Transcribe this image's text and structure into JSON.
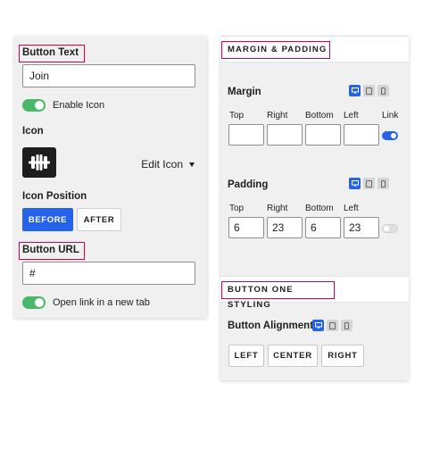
{
  "left": {
    "button_text": {
      "label": "Button Text",
      "value": "Join"
    },
    "enable_icon": {
      "label": "Enable Icon",
      "on": true
    },
    "icon": {
      "label": "Icon",
      "selected": "Edit Icon"
    },
    "icon_position": {
      "label": "Icon Position",
      "options": [
        "BEFORE",
        "AFTER"
      ],
      "selected": "BEFORE"
    },
    "button_url": {
      "label": "Button URL",
      "value": "#"
    },
    "new_tab": {
      "label": "Open link in a new tab",
      "on": true
    }
  },
  "right": {
    "margin_padding": {
      "title": "MARGIN & PADDING"
    },
    "margin": {
      "label": "Margin",
      "sides": [
        "Top",
        "Right",
        "Bottom",
        "Left"
      ],
      "link_label": "Link",
      "values": [
        "",
        "",
        "",
        ""
      ],
      "linked": true
    },
    "padding": {
      "label": "Padding",
      "sides": [
        "Top",
        "Right",
        "Bottom",
        "Left"
      ],
      "values": [
        "6",
        "23",
        "6",
        "23"
      ],
      "linked": false
    },
    "button_styling": {
      "title": "BUTTON ONE STYLING"
    },
    "alignment": {
      "label": "Button Alignment",
      "options": [
        "LEFT",
        "CENTER",
        "RIGHT"
      ]
    }
  },
  "colors": {
    "accent": "#2563eb",
    "toggle_on": "#4ab866",
    "highlight": "#d4004e"
  },
  "icons": {
    "device_icons": [
      "desktop-icon",
      "tablet-icon",
      "mobile-icon"
    ],
    "preview_icon": "dumbbell-icon"
  }
}
